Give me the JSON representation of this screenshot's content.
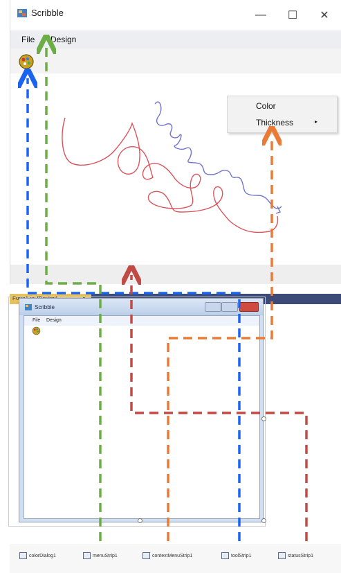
{
  "app": {
    "title": "Scribble",
    "icon": "paint-palette-icon",
    "controls": {
      "minimize": "—",
      "maximize": "☐",
      "close": "✕"
    },
    "menu": [
      "File",
      "Design"
    ],
    "context_menu": {
      "items": [
        "Color",
        "Thickness"
      ],
      "submenu_arrow": "▸"
    }
  },
  "designer": {
    "tab_label": "Form1.cs [Design]",
    "tab_close": "✕",
    "form_title": "Scribble",
    "form_menu": [
      "File",
      "Design"
    ],
    "tray": [
      {
        "label": "colorDialog1",
        "icon": "component-icon"
      },
      {
        "label": "menuStrip1",
        "icon": "menu-strip-icon"
      },
      {
        "label": "contextMenuStrip1",
        "icon": "context-menu-icon"
      },
      {
        "label": "toolStrip1",
        "icon": "tool-strip-icon"
      },
      {
        "label": "statusStrip1",
        "icon": "status-strip-icon"
      }
    ]
  },
  "colors": {
    "stroke_red": "#d9545c",
    "stroke_blue": "#6f73cf",
    "arrow_blue": "#1a64ef",
    "arrow_green": "#6cae45",
    "arrow_orange": "#ea7b37",
    "arrow_red": "#c24a45"
  }
}
